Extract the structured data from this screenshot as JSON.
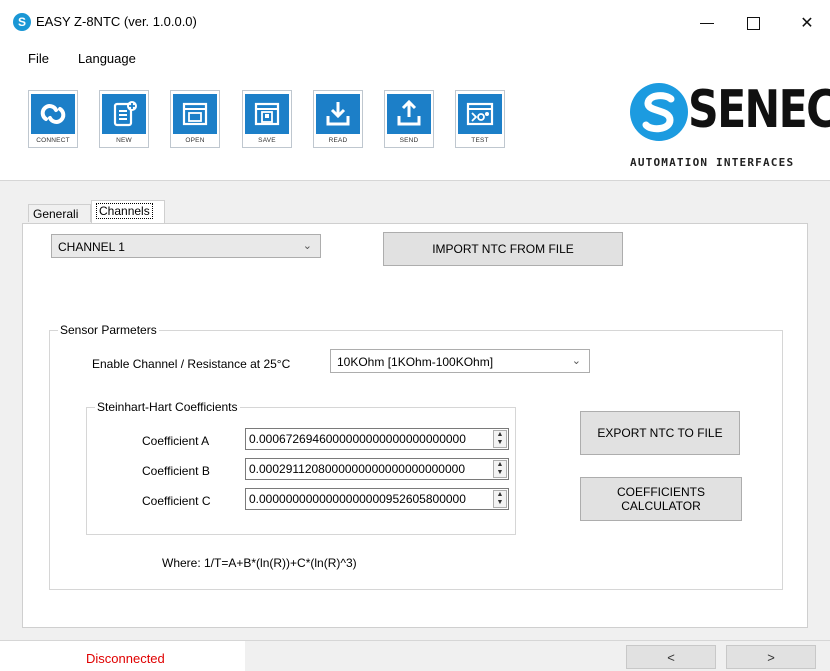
{
  "window": {
    "title": "EASY Z-8NTC (ver. 1.0.0.0)",
    "app_icon_letter": "S",
    "minimize_icon": "minimize-icon",
    "maximize_icon": "maximize-icon",
    "close_glyph": "✕"
  },
  "menu": {
    "file": "File",
    "language": "Language"
  },
  "toolbar": {
    "buttons": [
      {
        "label": "CONNECT",
        "icon": "connect-icon"
      },
      {
        "label": "NEW",
        "icon": "new-file-icon"
      },
      {
        "label": "OPEN",
        "icon": "open-icon"
      },
      {
        "label": "SAVE",
        "icon": "save-icon"
      },
      {
        "label": "READ",
        "icon": "download-icon"
      },
      {
        "label": "SEND",
        "icon": "upload-icon"
      },
      {
        "label": "TEST",
        "icon": "test-icon"
      }
    ],
    "accent": "#1c7fc8"
  },
  "logo": {
    "word": "SENECA",
    "tagline": "AUTOMATION INTERFACES",
    "color": "#1c9be0"
  },
  "tabs": {
    "generali": "Generali",
    "channels": "Channels"
  },
  "channels": {
    "selected_channel": "CHANNEL 1",
    "import_button": "IMPORT NTC FROM FILE",
    "sensor_group_title": "Sensor Parmeters",
    "enable_label": "Enable Channel / Resistance at 25°C",
    "resistance_value": "10KOhm [1KOhm-100KOhm]",
    "sh_group_title": "Steinhart-Hart Coefficients",
    "coefficients": [
      {
        "label": "Coefficient A",
        "value": "0.0006726946000000000000000000000"
      },
      {
        "label": "Coefficient B",
        "value": "0.0002911208000000000000000000000"
      },
      {
        "label": "Coefficient C",
        "value": "0.0000000000000000000952605800000"
      }
    ],
    "export_button": "EXPORT NTC TO FILE",
    "calculator_button_line1": "COEFFICIENTS",
    "calculator_button_line2": "CALCULATOR",
    "formula": "Where: 1/T=A+B*(ln(R))+C*(ln(R)^3)"
  },
  "status": {
    "connection": "Disconnected",
    "connection_color": "#e00000",
    "prev": "<",
    "next": ">"
  }
}
